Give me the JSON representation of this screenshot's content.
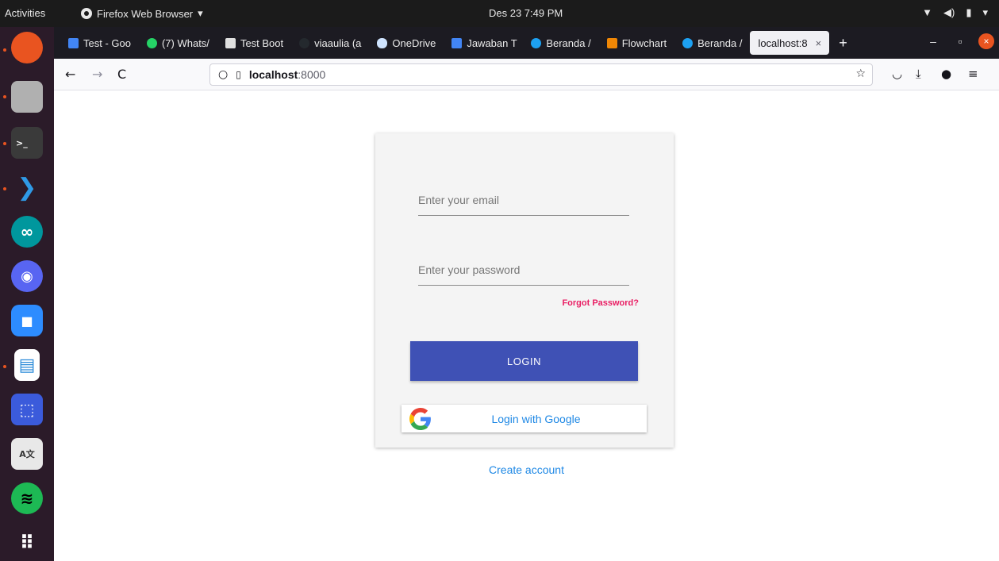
{
  "os": {
    "activities": "Activities",
    "app_name": "Firefox Web Browser",
    "app_menu_arrow": "▾",
    "clock": "Des 23  7:49 PM",
    "tray": [
      "▼",
      "◀)",
      "▮",
      "▾"
    ]
  },
  "dock": {
    "items": [
      {
        "name": "firefox",
        "glyph": "",
        "color": "#e95420",
        "running": true
      },
      {
        "name": "files",
        "glyph": "",
        "color": "#9e9e9e",
        "running": true
      },
      {
        "name": "terminal",
        "glyph": ">_",
        "color": "#3a3a3a",
        "running": true
      },
      {
        "name": "vscode",
        "glyph": "❯",
        "color": "#2b1b29",
        "running": true
      },
      {
        "name": "arduino",
        "glyph": "∞",
        "color": "#00979d",
        "running": false
      },
      {
        "name": "discord",
        "glyph": "◉",
        "color": "#5865f2",
        "running": false
      },
      {
        "name": "zoom",
        "glyph": "■",
        "color": "#2d8cff",
        "running": false
      },
      {
        "name": "libreoffice-impress",
        "glyph": "▤",
        "color": "#2a8ad8",
        "running": true
      },
      {
        "name": "screenshot",
        "glyph": "⬚",
        "color": "#3b5bdb",
        "running": false
      },
      {
        "name": "translate",
        "glyph": "A文",
        "color": "#e8e8e8",
        "running": false
      },
      {
        "name": "spotify",
        "glyph": "≋",
        "color": "#1db954",
        "running": false
      },
      {
        "name": "show-apps",
        "glyph": "⠿",
        "color": "#2b1b29",
        "running": false
      }
    ]
  },
  "browser": {
    "tabs": [
      {
        "label": "Test - Goo",
        "fav_color": "#4285f4"
      },
      {
        "label": "(7) Whats/",
        "fav_color": "#25d366"
      },
      {
        "label": "Test Boot",
        "fav_color": "#555555"
      },
      {
        "label": "viaaulia (a",
        "fav_color": "#24292e"
      },
      {
        "label": "OneDrive",
        "fav_color": "#0078d4"
      },
      {
        "label": "Jawaban T",
        "fav_color": "#4285f4"
      },
      {
        "label": "Beranda /",
        "fav_color": "#1da1f2"
      },
      {
        "label": "Flowchart",
        "fav_color": "#f08705"
      },
      {
        "label": "Beranda /",
        "fav_color": "#1da1f2"
      }
    ],
    "active_tab": {
      "label": "localhost:8",
      "close": "×"
    },
    "new_tab": "+",
    "window": {
      "minimize": "–",
      "restore": "▫",
      "close": "×"
    },
    "nav": {
      "back": "←",
      "forward": "→",
      "reload": "C"
    },
    "url": {
      "host": "localhost",
      "port": ":8000"
    },
    "right_icons": {
      "bookmark": "☆",
      "pocket": "◡",
      "downloads": "⤓",
      "account": "●",
      "menu": "≡"
    }
  },
  "page": {
    "email_placeholder": "Enter your email",
    "password_placeholder": "Enter your password",
    "forgot_password": "Forgot Password?",
    "login_button": "LOGIN",
    "google_button": "Login with Google",
    "create_account": "Create account",
    "colors": {
      "primary": "#3f51b5",
      "link": "#1e88e5",
      "accent": "#e91e63",
      "card": "#f4f4f4"
    }
  }
}
